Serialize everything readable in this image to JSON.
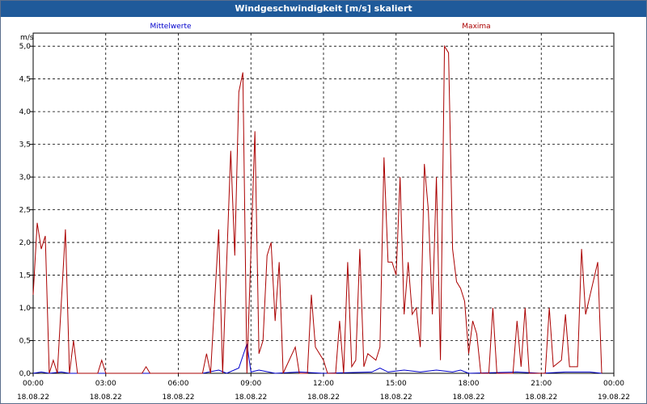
{
  "window": {
    "title": "Windgeschwindigkeit [m/s] skaliert"
  },
  "chart_data": {
    "type": "line",
    "title": "Windgeschwindigkeit [m/s] skaliert",
    "ylabel": "m/s",
    "ylim": [
      0,
      5.2
    ],
    "xlim": [
      "2022-08-18T00:00",
      "2022-08-19T00:00"
    ],
    "y_ticks": [
      "0,0",
      "0,5",
      "1,0",
      "1,5",
      "2,0",
      "2,5",
      "3,0",
      "3,5",
      "4,0",
      "4,5",
      "5,0"
    ],
    "y_tick_values": [
      0,
      0.5,
      1,
      1.5,
      2,
      2.5,
      3,
      3.5,
      4,
      4.5,
      5
    ],
    "x_ticks": [
      {
        "time": "00:00",
        "date": "18.08.22",
        "at": "2022-08-18T00:00"
      },
      {
        "time": "03:00",
        "date": "18.08.22",
        "at": "2022-08-18T03:00"
      },
      {
        "time": "06:00",
        "date": "18.08.22",
        "at": "2022-08-18T06:00"
      },
      {
        "time": "09:00",
        "date": "18.08.22",
        "at": "2022-08-18T09:00"
      },
      {
        "time": "12:00",
        "date": "18.08.22",
        "at": "2022-08-18T12:00"
      },
      {
        "time": "15:00",
        "date": "18.08.22",
        "at": "2022-08-18T15:00"
      },
      {
        "time": "18:00",
        "date": "18.08.22",
        "at": "2022-08-18T18:00"
      },
      {
        "time": "21:00",
        "date": "18.08.22",
        "at": "2022-08-18T21:00"
      },
      {
        "time": "00:00",
        "date": "19.08.22",
        "at": "2022-08-19T00:00"
      }
    ],
    "grid": true,
    "series": [
      {
        "name": "Mittelwerte",
        "color": "#0000cc",
        "legend": "top-left",
        "points": [
          [
            "2022-08-18T00:00",
            0
          ],
          [
            "2022-08-18T00:20",
            0.02
          ],
          [
            "2022-08-18T00:40",
            0
          ],
          [
            "2022-08-18T01:10",
            0.02
          ],
          [
            "2022-08-18T01:30",
            0
          ],
          [
            "2022-08-18T07:00",
            0
          ],
          [
            "2022-08-18T07:40",
            0.05
          ],
          [
            "2022-08-18T08:00",
            0
          ],
          [
            "2022-08-18T08:30",
            0.08
          ],
          [
            "2022-08-18T08:50",
            0.45
          ],
          [
            "2022-08-18T09:00",
            0.02
          ],
          [
            "2022-08-18T09:20",
            0.05
          ],
          [
            "2022-08-18T10:00",
            0
          ],
          [
            "2022-08-18T11:00",
            0.02
          ],
          [
            "2022-08-18T12:00",
            0
          ],
          [
            "2022-08-18T14:00",
            0.02
          ],
          [
            "2022-08-18T14:20",
            0.08
          ],
          [
            "2022-08-18T14:40",
            0.02
          ],
          [
            "2022-08-18T15:20",
            0.05
          ],
          [
            "2022-08-18T16:00",
            0.02
          ],
          [
            "2022-08-18T16:40",
            0.05
          ],
          [
            "2022-08-18T17:20",
            0.02
          ],
          [
            "2022-08-18T17:40",
            0.05
          ],
          [
            "2022-08-18T18:00",
            0
          ],
          [
            "2022-08-18T20:00",
            0.02
          ],
          [
            "2022-08-18T21:00",
            0
          ],
          [
            "2022-08-18T22:00",
            0.02
          ],
          [
            "2022-08-18T23:00",
            0.02
          ],
          [
            "2022-08-18T23:30",
            0
          ]
        ]
      },
      {
        "name": "Maxima",
        "color": "#aa0000",
        "legend": "top-right",
        "points": [
          [
            "2022-08-18T00:00",
            1.2
          ],
          [
            "2022-08-18T00:10",
            2.3
          ],
          [
            "2022-08-18T00:20",
            1.9
          ],
          [
            "2022-08-18T00:30",
            2.1
          ],
          [
            "2022-08-18T00:40",
            0
          ],
          [
            "2022-08-18T00:50",
            0.2
          ],
          [
            "2022-08-18T01:00",
            0
          ],
          [
            "2022-08-18T01:20",
            2.2
          ],
          [
            "2022-08-18T01:30",
            0
          ],
          [
            "2022-08-18T01:40",
            0.5
          ],
          [
            "2022-08-18T01:50",
            0
          ],
          [
            "2022-08-18T02:40",
            0
          ],
          [
            "2022-08-18T02:50",
            0.2
          ],
          [
            "2022-08-18T03:00",
            0
          ],
          [
            "2022-08-18T04:30",
            0
          ],
          [
            "2022-08-18T04:40",
            0.1
          ],
          [
            "2022-08-18T04:50",
            0
          ],
          [
            "2022-08-18T07:00",
            0
          ],
          [
            "2022-08-18T07:10",
            0.3
          ],
          [
            "2022-08-18T07:20",
            0
          ],
          [
            "2022-08-18T07:40",
            2.2
          ],
          [
            "2022-08-18T07:50",
            0
          ],
          [
            "2022-08-18T08:10",
            3.4
          ],
          [
            "2022-08-18T08:20",
            1.8
          ],
          [
            "2022-08-18T08:30",
            4.3
          ],
          [
            "2022-08-18T08:40",
            4.6
          ],
          [
            "2022-08-18T08:50",
            0
          ],
          [
            "2022-08-18T09:10",
            3.7
          ],
          [
            "2022-08-18T09:20",
            0.3
          ],
          [
            "2022-08-18T09:30",
            0.5
          ],
          [
            "2022-08-18T09:40",
            1.8
          ],
          [
            "2022-08-18T09:50",
            2.0
          ],
          [
            "2022-08-18T10:00",
            0.8
          ],
          [
            "2022-08-18T10:10",
            1.7
          ],
          [
            "2022-08-18T10:20",
            0
          ],
          [
            "2022-08-18T10:50",
            0.4
          ],
          [
            "2022-08-18T11:00",
            0
          ],
          [
            "2022-08-18T11:20",
            0
          ],
          [
            "2022-08-18T11:30",
            1.2
          ],
          [
            "2022-08-18T11:40",
            0.4
          ],
          [
            "2022-08-18T12:00",
            0.2
          ],
          [
            "2022-08-18T12:10",
            0
          ],
          [
            "2022-08-18T12:30",
            0
          ],
          [
            "2022-08-18T12:40",
            0.8
          ],
          [
            "2022-08-18T12:50",
            0
          ],
          [
            "2022-08-18T13:00",
            1.7
          ],
          [
            "2022-08-18T13:10",
            0.1
          ],
          [
            "2022-08-18T13:20",
            0.2
          ],
          [
            "2022-08-18T13:30",
            1.9
          ],
          [
            "2022-08-18T13:40",
            0.1
          ],
          [
            "2022-08-18T13:50",
            0.3
          ],
          [
            "2022-08-18T14:10",
            0.2
          ],
          [
            "2022-08-18T14:20",
            0.4
          ],
          [
            "2022-08-18T14:30",
            3.3
          ],
          [
            "2022-08-18T14:40",
            1.7
          ],
          [
            "2022-08-18T14:50",
            1.7
          ],
          [
            "2022-08-18T15:00",
            1.5
          ],
          [
            "2022-08-18T15:10",
            3.0
          ],
          [
            "2022-08-18T15:20",
            0.9
          ],
          [
            "2022-08-18T15:30",
            1.7
          ],
          [
            "2022-08-18T15:40",
            0.9
          ],
          [
            "2022-08-18T15:50",
            1.0
          ],
          [
            "2022-08-18T16:00",
            0.4
          ],
          [
            "2022-08-18T16:10",
            3.2
          ],
          [
            "2022-08-18T16:20",
            2.5
          ],
          [
            "2022-08-18T16:30",
            0.9
          ],
          [
            "2022-08-18T16:40",
            3.0
          ],
          [
            "2022-08-18T16:50",
            0.2
          ],
          [
            "2022-08-18T17:00",
            5.0
          ],
          [
            "2022-08-18T17:10",
            4.9
          ],
          [
            "2022-08-18T17:20",
            1.9
          ],
          [
            "2022-08-18T17:30",
            1.4
          ],
          [
            "2022-08-18T17:40",
            1.3
          ],
          [
            "2022-08-18T17:50",
            1.1
          ],
          [
            "2022-08-18T18:00",
            0.3
          ],
          [
            "2022-08-18T18:10",
            0.8
          ],
          [
            "2022-08-18T18:20",
            0.6
          ],
          [
            "2022-08-18T18:30",
            0
          ],
          [
            "2022-08-18T18:50",
            0
          ],
          [
            "2022-08-18T19:00",
            1.0
          ],
          [
            "2022-08-18T19:10",
            0
          ],
          [
            "2022-08-18T19:50",
            0
          ],
          [
            "2022-08-18T20:00",
            0.8
          ],
          [
            "2022-08-18T20:10",
            0.1
          ],
          [
            "2022-08-18T20:20",
            1.0
          ],
          [
            "2022-08-18T20:30",
            0
          ],
          [
            "2022-08-18T21:10",
            0
          ],
          [
            "2022-08-18T21:20",
            1.0
          ],
          [
            "2022-08-18T21:30",
            0.1
          ],
          [
            "2022-08-18T21:50",
            0.2
          ],
          [
            "2022-08-18T22:00",
            0.9
          ],
          [
            "2022-08-18T22:10",
            0.1
          ],
          [
            "2022-08-18T22:30",
            0.1
          ],
          [
            "2022-08-18T22:40",
            1.9
          ],
          [
            "2022-08-18T22:50",
            0.9
          ],
          [
            "2022-08-18T23:20",
            1.7
          ],
          [
            "2022-08-18T23:30",
            0
          ]
        ]
      }
    ]
  }
}
